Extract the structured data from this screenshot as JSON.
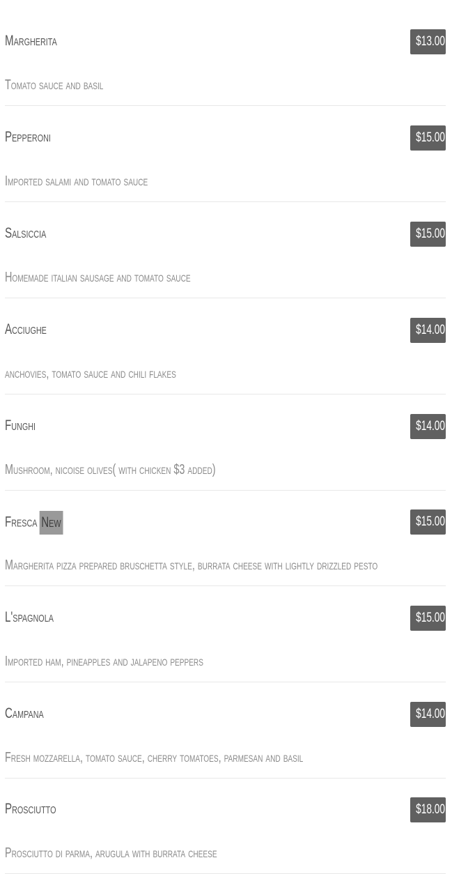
{
  "menu": {
    "items": [
      {
        "name": "Margherita",
        "badge": "",
        "price": "$13.00",
        "description": "Tomato sauce and basil"
      },
      {
        "name": "Pepperoni",
        "badge": "",
        "price": "$15.00",
        "description": "Imported salami and tomato sauce"
      },
      {
        "name": "Salsiccia",
        "badge": "",
        "price": "$15.00",
        "description": "Homemade italian sausage and tomato sauce"
      },
      {
        "name": "Acciughe",
        "badge": "",
        "price": "$14.00",
        "description": "anchovies, tomato sauce and chili flakes"
      },
      {
        "name": "Funghi",
        "badge": "",
        "price": "$14.00",
        "description": "Mushroom, nicoise olives( with chicken $3 added)"
      },
      {
        "name": "Fresca",
        "badge": "New",
        "price": "$15.00",
        "description": "Margherita pizza prepared bruschetta style, burrata cheese with lightly drizzled pesto"
      },
      {
        "name": "L'spagnola",
        "badge": "",
        "price": "$15.00",
        "description": "Imported ham, pineapples and jalapeno peppers"
      },
      {
        "name": "Campana",
        "badge": "",
        "price": "$14.00",
        "description": "Fresh mozzarella, tomato sauce, cherry tomatoes, parmesan and basil"
      },
      {
        "name": "Prosciutto",
        "badge": "",
        "price": "$18.00",
        "description": "Prosciutto di parma, arugula with burrata cheese"
      }
    ]
  }
}
